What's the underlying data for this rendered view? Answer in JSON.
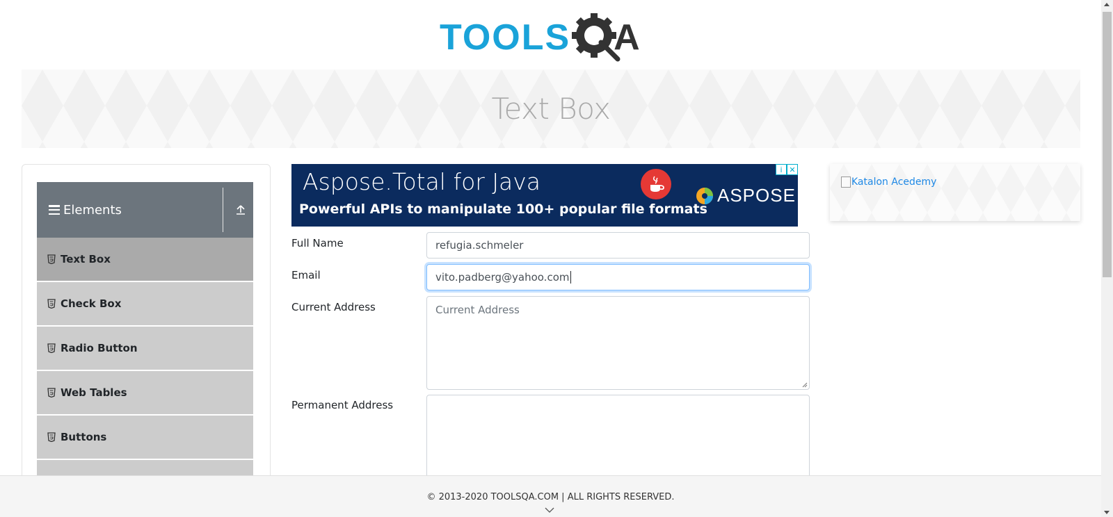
{
  "logo": {
    "text": "TOOLS",
    "suffix": "A",
    "icon": "gear-search-icon"
  },
  "banner": {
    "title": "Text Box"
  },
  "sidebar": {
    "group_title": "Elements",
    "group_icon": "hamburger-icon",
    "collapse_icon": "upload-arrow-icon",
    "items": [
      {
        "label": "Text Box",
        "active": true
      },
      {
        "label": "Check Box"
      },
      {
        "label": "Radio Button"
      },
      {
        "label": "Web Tables"
      },
      {
        "label": "Buttons"
      }
    ]
  },
  "ad": {
    "title": "Aspose.Total for Java",
    "subtitle": "Powerful APIs to manipulate 100+ popular file formats",
    "brand": "ASPOSE"
  },
  "form": {
    "full_name": {
      "label": "Full Name",
      "value": "refugia.schmeler"
    },
    "email": {
      "label": "Email",
      "value": "vito.padberg@yahoo.com"
    },
    "current_address": {
      "label": "Current Address",
      "placeholder": "Current Address"
    },
    "permanent_address": {
      "label": "Permanent Address"
    }
  },
  "right_ad": {
    "alt": "Katalon Acedemy"
  },
  "footer": {
    "copyright": "© 2013-2020 TOOLSQA.COM | ALL RIGHTS RESERVED."
  },
  "colors": {
    "brand_blue": "#1aa3d9",
    "sidebar_header": "#6c757d",
    "menu_item": "#cccccc",
    "menu_item_active": "#aaaaaa"
  }
}
